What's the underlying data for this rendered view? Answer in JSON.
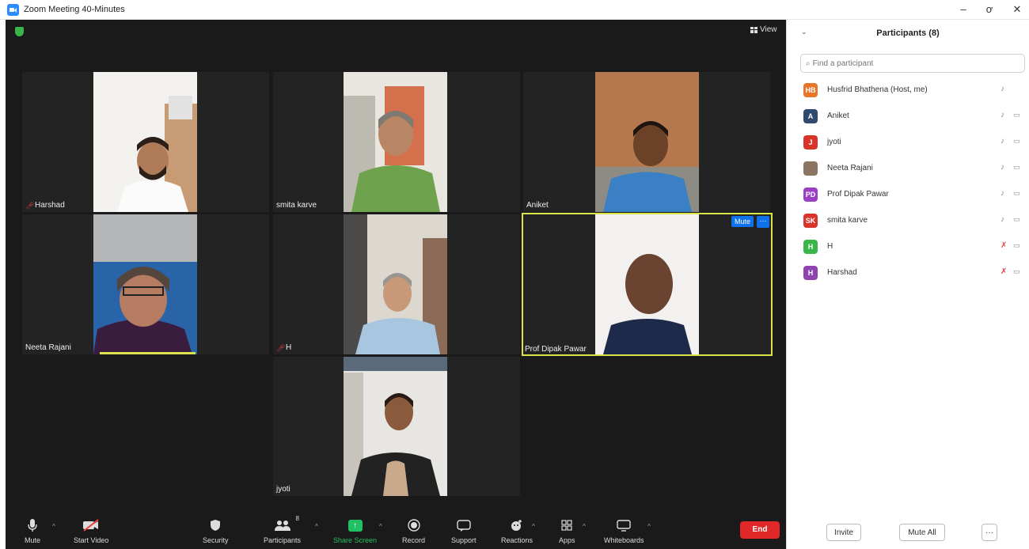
{
  "window": {
    "title": "Zoom Meeting 40-Minutes",
    "minimize": "–",
    "restore": "ơ",
    "close": "✕"
  },
  "stage": {
    "view_label": "View"
  },
  "tiles": [
    {
      "name": "Harshad",
      "mic_muted": true
    },
    {
      "name": "smita karve",
      "mic_muted": false
    },
    {
      "name": "Aniket",
      "mic_muted": false
    },
    {
      "name": "Neeta Rajani",
      "mic_muted": false
    },
    {
      "name": "H",
      "mic_muted": true
    },
    {
      "name": "Prof Dipak Pawar",
      "mic_muted": false,
      "active": true,
      "mute_label": "Mute",
      "more_label": "···"
    },
    {
      "name": "jyoti",
      "mic_muted": false
    }
  ],
  "toolbar": {
    "mute": "Mute",
    "start_video": "Start Video",
    "security": "Security",
    "participants": "Participants",
    "participants_count": "8",
    "share_screen": "Share Screen",
    "record": "Record",
    "support": "Support",
    "reactions": "Reactions",
    "apps": "Apps",
    "whiteboards": "Whiteboards",
    "end": "End"
  },
  "panel": {
    "title": "Participants (8)",
    "search_placeholder": "Find a participant",
    "participants": [
      {
        "initials": "HB",
        "name": "Husfrid Bhathena (Host, me)",
        "color": "#e8742a",
        "mic": "on",
        "cam": false
      },
      {
        "initials": "A",
        "name": "Aniket",
        "color": "#2f4a6d",
        "mic": "on",
        "cam": true
      },
      {
        "initials": "J",
        "name": "jyoti",
        "color": "#d9342b",
        "mic": "on",
        "cam": true
      },
      {
        "initials": "",
        "name": "Neeta Rajani",
        "color": "#8a7560",
        "mic": "on",
        "cam": true
      },
      {
        "initials": "PD",
        "name": "Prof Dipak Pawar",
        "color": "#9b3fc4",
        "mic": "on",
        "cam": true
      },
      {
        "initials": "SK",
        "name": "smita karve",
        "color": "#d9342b",
        "mic": "on",
        "cam": true
      },
      {
        "initials": "H",
        "name": "H",
        "color": "#3ab549",
        "mic": "off",
        "cam": true
      },
      {
        "initials": "H",
        "name": "Harshad",
        "color": "#8e44ad",
        "mic": "off",
        "cam": true
      }
    ],
    "invite": "Invite",
    "mute_all": "Mute All",
    "more": "···"
  }
}
